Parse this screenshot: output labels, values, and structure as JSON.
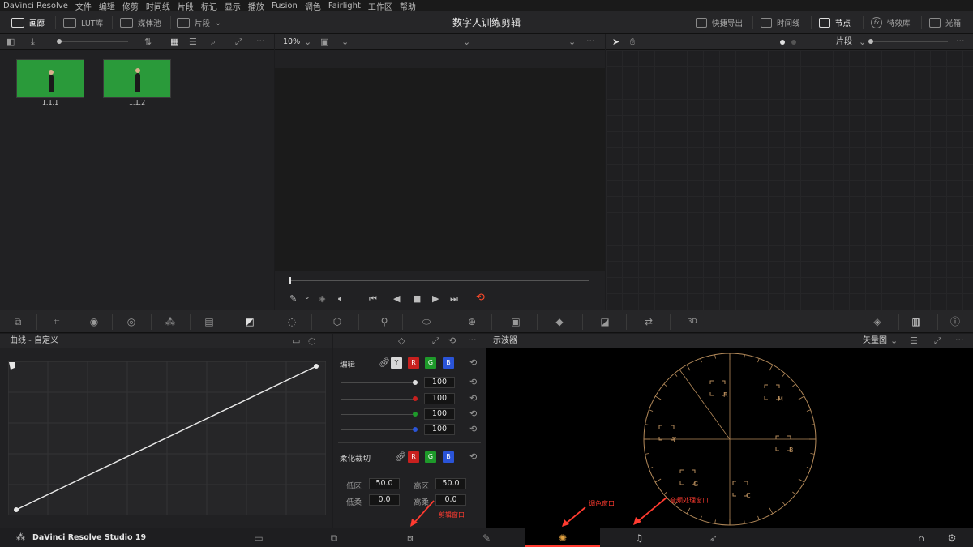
{
  "menu": [
    "DaVinci Resolve",
    "文件",
    "编辑",
    "修剪",
    "时间线",
    "片段",
    "标记",
    "显示",
    "播放",
    "Fusion",
    "调色",
    "Fairlight",
    "工作区",
    "帮助"
  ],
  "project_title": "数字人训练剪辑",
  "toolbar_left": {
    "gallery": "画廊",
    "lut": "LUT库",
    "media_pool": "媒体池",
    "clips": "片段"
  },
  "toolbar_right": {
    "quick_export": "快捷导出",
    "timeline": "时间线",
    "nodes": "节点",
    "effects": "特效库",
    "lightbox": "光箱"
  },
  "media": {
    "clips": [
      {
        "label": "1.1.1"
      },
      {
        "label": "1.1.2"
      }
    ]
  },
  "viewer": {
    "zoom": "10%"
  },
  "nodes": {
    "mode": "片段"
  },
  "curves": {
    "title": "曲线 - 自定义",
    "edit_label": "编辑",
    "channels": [
      "Y",
      "R",
      "G",
      "B"
    ],
    "channel_colors": [
      "#d8d8d8",
      "#c8201e",
      "#1e9a2a",
      "#2a54d8"
    ],
    "intensity": [
      "100",
      "100",
      "100",
      "100"
    ],
    "soft_clip": {
      "label": "柔化裁切",
      "low_label": "低区",
      "low_value": "50.0",
      "high_label": "高区",
      "high_value": "50.0",
      "low_soft_label": "低柔",
      "low_soft_value": "0.0",
      "high_soft_label": "高柔",
      "high_soft_value": "0.0"
    }
  },
  "scope": {
    "title": "示波器",
    "mode": "矢量图",
    "targets": [
      "R",
      "M",
      "B",
      "C",
      "G",
      "Y"
    ],
    "color": "#b48a5a"
  },
  "annotations": {
    "edit_window": "剪辑窗口",
    "color_window": "调色窗口",
    "audio_window": "音频处理窗口"
  },
  "app_name": "DaVinci Resolve Studio 19"
}
